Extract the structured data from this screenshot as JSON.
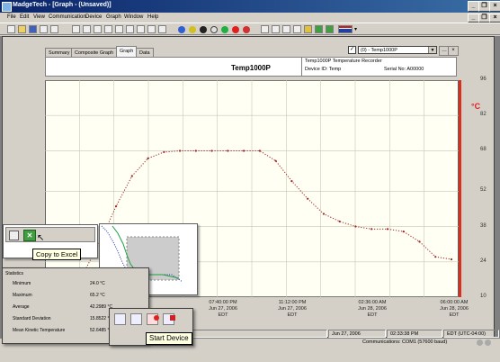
{
  "window": {
    "title": "MadgeTech - [Graph - (Unsaved)]"
  },
  "menus": [
    "File",
    "Edit",
    "View",
    "Communication",
    "Device",
    "Graph",
    "Window",
    "Help"
  ],
  "tabs": [
    "Summary",
    "Composite Graph",
    "Graph",
    "Data"
  ],
  "active_tab": "Graph",
  "channel_select": {
    "value": "(0) - Temp1000P",
    "checked": "✓"
  },
  "info": {
    "device_name": "Temp1000P",
    "description": "Temp1000P  Temperature Recorder",
    "device_id": "Device ID: Temp",
    "serial": "Serial No: A00000"
  },
  "chart_data": {
    "type": "line",
    "ylabel": "°C",
    "ylim": [
      10,
      96
    ],
    "y_ticks": [
      "96",
      "82",
      "68",
      "52",
      "38",
      "24",
      "10"
    ],
    "x_ticks": [
      "07:40:00 PM\nJun 27, 2006\nEDT",
      "11:12:00 PM\nJun 27, 2006\nEDT",
      "02:36:00 AM\nJun 28, 2006\nEDT",
      "06:00:00 AM\nJun 28, 2006\nEDT"
    ],
    "x": [
      0,
      4,
      8,
      12,
      16,
      20,
      24,
      28,
      32,
      36,
      40,
      44,
      48,
      52,
      56,
      60,
      64,
      68,
      72,
      76,
      80,
      84,
      88,
      92,
      96,
      100
    ],
    "values": [
      12,
      14,
      20,
      32,
      46,
      58,
      65,
      67.5,
      68,
      68,
      68,
      68,
      68,
      68,
      64,
      56,
      49,
      43,
      40,
      38,
      37,
      37,
      36,
      32,
      26,
      25
    ],
    "series_color": "#a02020",
    "axis_color": "#d83020"
  },
  "overlay_copy": {
    "tooltip": "Copy to Excel"
  },
  "statistics": {
    "title": "Statistics",
    "rows": [
      {
        "label": "Minimum",
        "value": "24.0 °C"
      },
      {
        "label": "Maximum",
        "value": "65.2 °C"
      },
      {
        "label": "Average",
        "value": "42.2989 °C"
      },
      {
        "label": "Standard Deviation",
        "value": "15.8522 °C"
      },
      {
        "label": "Mean Kinetic Temperature",
        "value": "52.6485 °C"
      }
    ]
  },
  "overlay_device": {
    "tooltip": "Start Device"
  },
  "status": {
    "date": "Jun 27, 2006",
    "time": "02:33:38 PM",
    "timezone": "EDT (UTC-04:00)",
    "comm": "Communications: COM1 (57600 baud)"
  }
}
